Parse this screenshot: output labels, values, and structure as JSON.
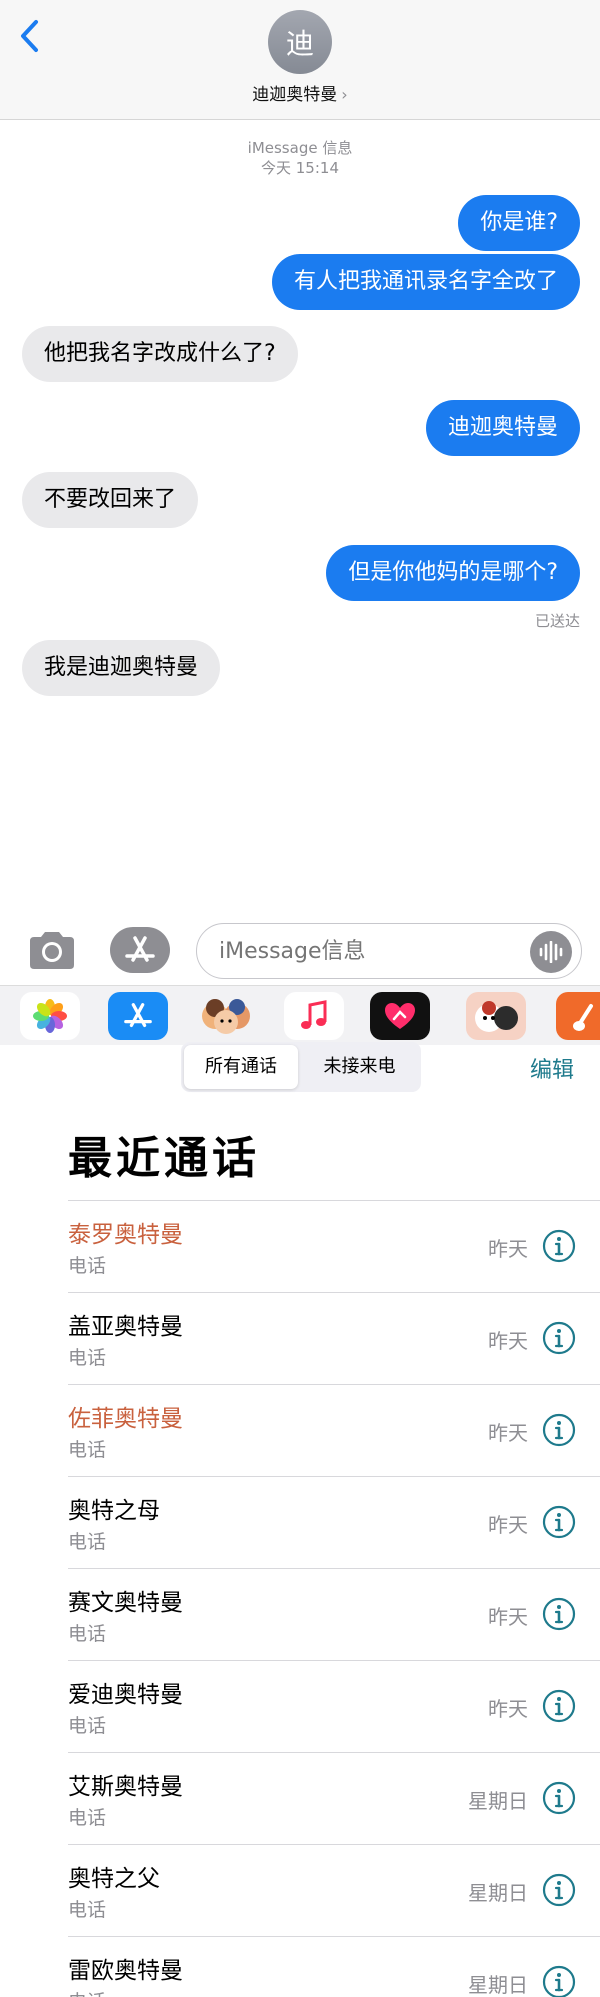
{
  "header": {
    "avatar_letter": "迪",
    "contact_name": "迪迦奥特曼",
    "chevron": "›"
  },
  "thread": {
    "service_label": "iMessage 信息",
    "timestamp": "今天 15:14",
    "messages": [
      {
        "dir": "out",
        "text": "你是谁?"
      },
      {
        "dir": "out",
        "text": "有人把我通讯录名字全改了"
      },
      {
        "dir": "in",
        "text": "他把我名字改成什么了?"
      },
      {
        "dir": "out",
        "text": "迪迦奥特曼"
      },
      {
        "dir": "in",
        "text": "不要改回来了"
      },
      {
        "dir": "out",
        "text": "但是你他妈的是哪个?"
      },
      {
        "dir": "in",
        "text": "我是迪迦奥特曼"
      }
    ],
    "delivered_label": "已送达"
  },
  "input_bar": {
    "placeholder": "iMessage信息"
  },
  "app_strip": {
    "apps": [
      "photos-app-icon",
      "app-store-icon",
      "memoji-icon",
      "music-icon",
      "digital-touch-icon",
      "stickers-icon",
      "garageband-icon"
    ]
  },
  "phone": {
    "segments": [
      "所有通话",
      "未接来电"
    ],
    "edit_label": "编辑",
    "title": "最近通话",
    "calls": [
      {
        "name": "泰罗奥特曼",
        "type": "电话",
        "time": "昨天",
        "missed": true
      },
      {
        "name": "盖亚奥特曼",
        "type": "电话",
        "time": "昨天",
        "missed": false
      },
      {
        "name": "佐菲奥特曼",
        "type": "电话",
        "time": "昨天",
        "missed": true
      },
      {
        "name": "奥特之母",
        "type": "电话",
        "time": "昨天",
        "missed": false
      },
      {
        "name": "赛文奥特曼",
        "type": "电话",
        "time": "昨天",
        "missed": false
      },
      {
        "name": "爱迪奥特曼",
        "type": "电话",
        "time": "昨天",
        "missed": false
      },
      {
        "name": "艾斯奥特曼",
        "type": "电话",
        "time": "星期日",
        "missed": false
      },
      {
        "name": "奥特之父",
        "type": "电话",
        "time": "星期日",
        "missed": false
      },
      {
        "name": "雷欧奥特曼",
        "type": "电话",
        "time": "星期日",
        "missed": false
      }
    ]
  },
  "colors": {
    "imessage_blue": "#1b7cf0",
    "incoming_gray": "#e9e9eb",
    "missed_call": "#c9613e",
    "ios_link": "#1e7a8c"
  }
}
